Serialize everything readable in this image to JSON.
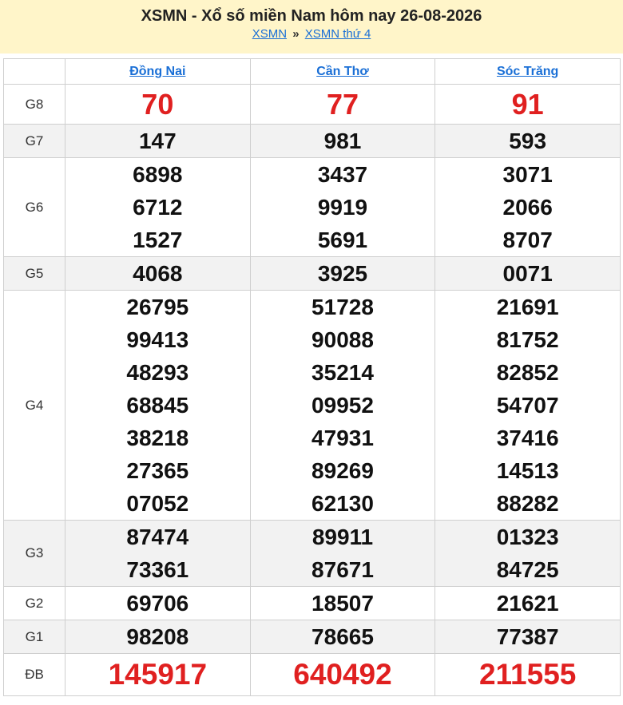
{
  "header": {
    "title": "XSMN - Xổ số miền Nam hôm nay 26-08-2026",
    "breadcrumb": [
      "XSMN",
      "XSMN thứ 4"
    ],
    "separator": "»"
  },
  "table": {
    "provinces": [
      "Đồng Nai",
      "Cần Thơ",
      "Sóc Trăng"
    ],
    "rows": [
      {
        "label": "G8",
        "values": [
          [
            "70"
          ],
          [
            "77"
          ],
          [
            "91"
          ]
        ]
      },
      {
        "label": "G7",
        "values": [
          [
            "147"
          ],
          [
            "981"
          ],
          [
            "593"
          ]
        ]
      },
      {
        "label": "G6",
        "values": [
          [
            "6898",
            "6712",
            "1527"
          ],
          [
            "3437",
            "9919",
            "5691"
          ],
          [
            "3071",
            "2066",
            "8707"
          ]
        ]
      },
      {
        "label": "G5",
        "values": [
          [
            "4068"
          ],
          [
            "3925"
          ],
          [
            "0071"
          ]
        ]
      },
      {
        "label": "G4",
        "values": [
          [
            "26795",
            "99413",
            "48293",
            "68845",
            "38218",
            "27365",
            "07052"
          ],
          [
            "51728",
            "90088",
            "35214",
            "09952",
            "47931",
            "89269",
            "62130"
          ],
          [
            "21691",
            "81752",
            "82852",
            "54707",
            "37416",
            "14513",
            "88282"
          ]
        ]
      },
      {
        "label": "G3",
        "values": [
          [
            "87474",
            "73361"
          ],
          [
            "89911",
            "87671"
          ],
          [
            "01323",
            "84725"
          ]
        ]
      },
      {
        "label": "G2",
        "values": [
          [
            "69706"
          ],
          [
            "18507"
          ],
          [
            "21621"
          ]
        ]
      },
      {
        "label": "G1",
        "values": [
          [
            "98208"
          ],
          [
            "78665"
          ],
          [
            "77387"
          ]
        ]
      },
      {
        "label": "ĐB",
        "values": [
          [
            "145917"
          ],
          [
            "640492"
          ],
          [
            "211555"
          ]
        ]
      }
    ]
  },
  "colors": {
    "header_bg": "#fff5c9",
    "link": "#1a6fd6",
    "highlight_red": "#e02020",
    "alt_row": "#f2f2f2"
  }
}
